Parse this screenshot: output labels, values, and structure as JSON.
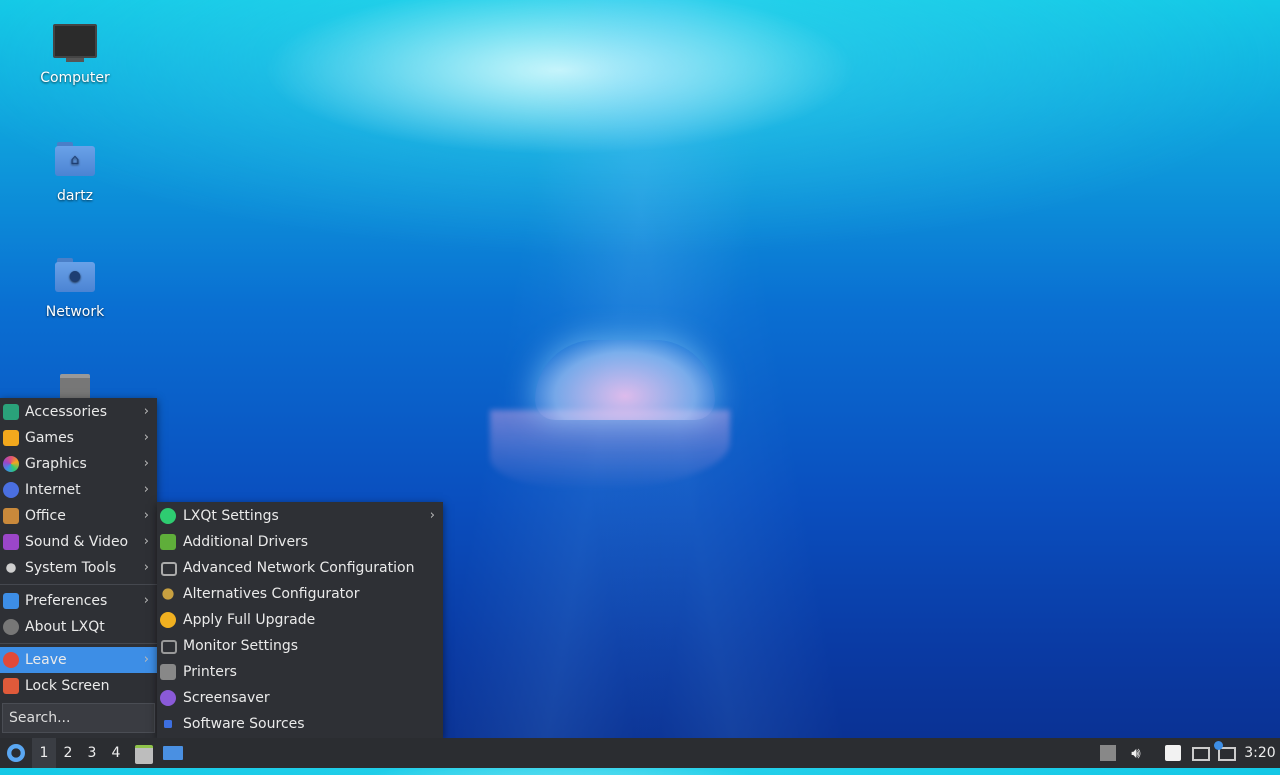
{
  "desktop": {
    "icons": [
      {
        "label": "Computer",
        "icon": "computer-icon"
      },
      {
        "label": "dartz",
        "icon": "home-folder-icon"
      },
      {
        "label": "Network",
        "icon": "network-folder-icon"
      },
      {
        "label": "",
        "icon": "trash-icon"
      }
    ]
  },
  "main_menu": {
    "items": [
      {
        "label": "Accessories",
        "icon": "accessories-icon",
        "color": "#2aa27a",
        "submenu": true
      },
      {
        "label": "Games",
        "icon": "games-icon",
        "color": "#f2a81d",
        "submenu": true
      },
      {
        "label": "Graphics",
        "icon": "graphics-icon",
        "color": "#e0507a",
        "submenu": true
      },
      {
        "label": "Internet",
        "icon": "internet-icon",
        "color": "#4a6fe0",
        "submenu": true
      },
      {
        "label": "Office",
        "icon": "office-icon",
        "color": "#c9893b",
        "submenu": true
      },
      {
        "label": "Sound & Video",
        "icon": "sound-video-icon",
        "color": "#9b46c9",
        "submenu": true
      },
      {
        "label": "System Tools",
        "icon": "system-tools-icon",
        "color": "#bbbbbb",
        "submenu": true
      },
      {
        "label": "Preferences",
        "icon": "preferences-icon",
        "color": "#3d8ee6",
        "submenu": true
      },
      {
        "label": "About LXQt",
        "icon": "about-icon",
        "color": "#888888",
        "submenu": false
      },
      {
        "label": "Leave",
        "icon": "power-icon",
        "color": "#e04a3a",
        "submenu": true
      },
      {
        "label": "Lock Screen",
        "icon": "lock-icon",
        "color": "#e05a3a",
        "submenu": false
      }
    ],
    "search_placeholder": "Search..."
  },
  "sub_menu": {
    "items": [
      {
        "label": "LXQt Settings",
        "icon": "lxqt-settings-icon",
        "color": "#2ecc71",
        "submenu": true
      },
      {
        "label": "Additional Drivers",
        "icon": "drivers-icon",
        "color": "#5fae3a",
        "submenu": false
      },
      {
        "label": "Advanced Network Configuration",
        "icon": "network-config-icon",
        "color": "#aaaaaa",
        "submenu": false
      },
      {
        "label": "Alternatives Configurator",
        "icon": "alternatives-icon",
        "color": "#c8a040",
        "submenu": false
      },
      {
        "label": "Apply Full Upgrade",
        "icon": "upgrade-icon",
        "color": "#f0b020",
        "submenu": false
      },
      {
        "label": "Monitor Settings",
        "icon": "monitor-icon",
        "color": "#999999",
        "submenu": false
      },
      {
        "label": "Printers",
        "icon": "printer-icon",
        "color": "#888888",
        "submenu": false
      },
      {
        "label": "Screensaver",
        "icon": "screensaver-icon",
        "color": "#8a5ad8",
        "submenu": false
      },
      {
        "label": "Software Sources",
        "icon": "software-sources-icon",
        "color": "#3d6fe0",
        "submenu": false
      }
    ]
  },
  "taskbar": {
    "desktops": [
      "1",
      "2",
      "3",
      "4"
    ],
    "active_desktop": "1",
    "clock": "3:20"
  }
}
